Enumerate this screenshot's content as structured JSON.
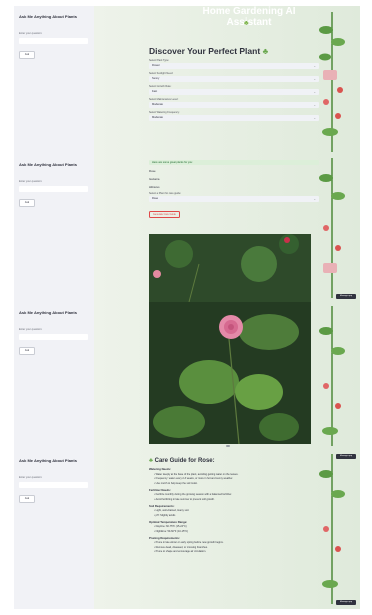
{
  "app": {
    "title": "Home Gardening AI Assistant",
    "subtitle_icon": "sprout-icon"
  },
  "sidebar": {
    "title": "Ask Me Anything About Plants",
    "input_label": "Enter your question:",
    "button_label": "Ask"
  },
  "finder": {
    "heading": "Discover Your Perfect Plant",
    "fields": [
      {
        "label": "Select Plant Type:",
        "value": "Flower"
      },
      {
        "label": "Select Sunlight Need:",
        "value": "Sunny"
      },
      {
        "label": "Select Growth Rate:",
        "value": "Fast"
      },
      {
        "label": "Select Maintenance Level:",
        "value": "Moderate"
      },
      {
        "label": "Select Watering Frequency:",
        "value": "Moderate"
      }
    ],
    "success_text": "Here are some great plants for you:",
    "results": [
      "Rose",
      "Gazania",
      "Hibiscus"
    ],
    "detail_label": "Select a Plant for care guide:",
    "detail_value": "Rose",
    "generate_label": "Generate Care Guide"
  },
  "deploy_label": "Manage app",
  "guide": {
    "heading": "Care Guide for Rose:",
    "sections": [
      {
        "head": "Watering Needs:",
        "items": [
          "Water deeply at the base of the plant, avoiding getting water on the leaves.",
          "Frequency: water every 2-3 weeks, or more in hot and sunny weather.",
          "Use mulch to help keep the soil moist."
        ]
      },
      {
        "head": "Fertilizer Needs:",
        "items": [
          "Fertilize monthly during the growing season with a balanced fertilizer.",
          "Avoid fertilizing in late summer to prevent soft growth."
        ]
      },
      {
        "head": "Soil Requirements:",
        "items": [
          "Light, well-drained, loamy soil.",
          "pH: Slightly acidic."
        ]
      },
      {
        "head": "Optimal Temperature Range:",
        "items": [
          "Daytime: 60-75°F (15-24°C)",
          "Nighttime: 50-60°F (10-15°C)"
        ]
      },
      {
        "head": "Pruning Requirements:",
        "items": [
          "Prune in late winter or early spring before new growth begins.",
          "Remove dead, diseased, or crossing branches.",
          "Prune to shape and encourage air circulation."
        ]
      }
    ]
  }
}
